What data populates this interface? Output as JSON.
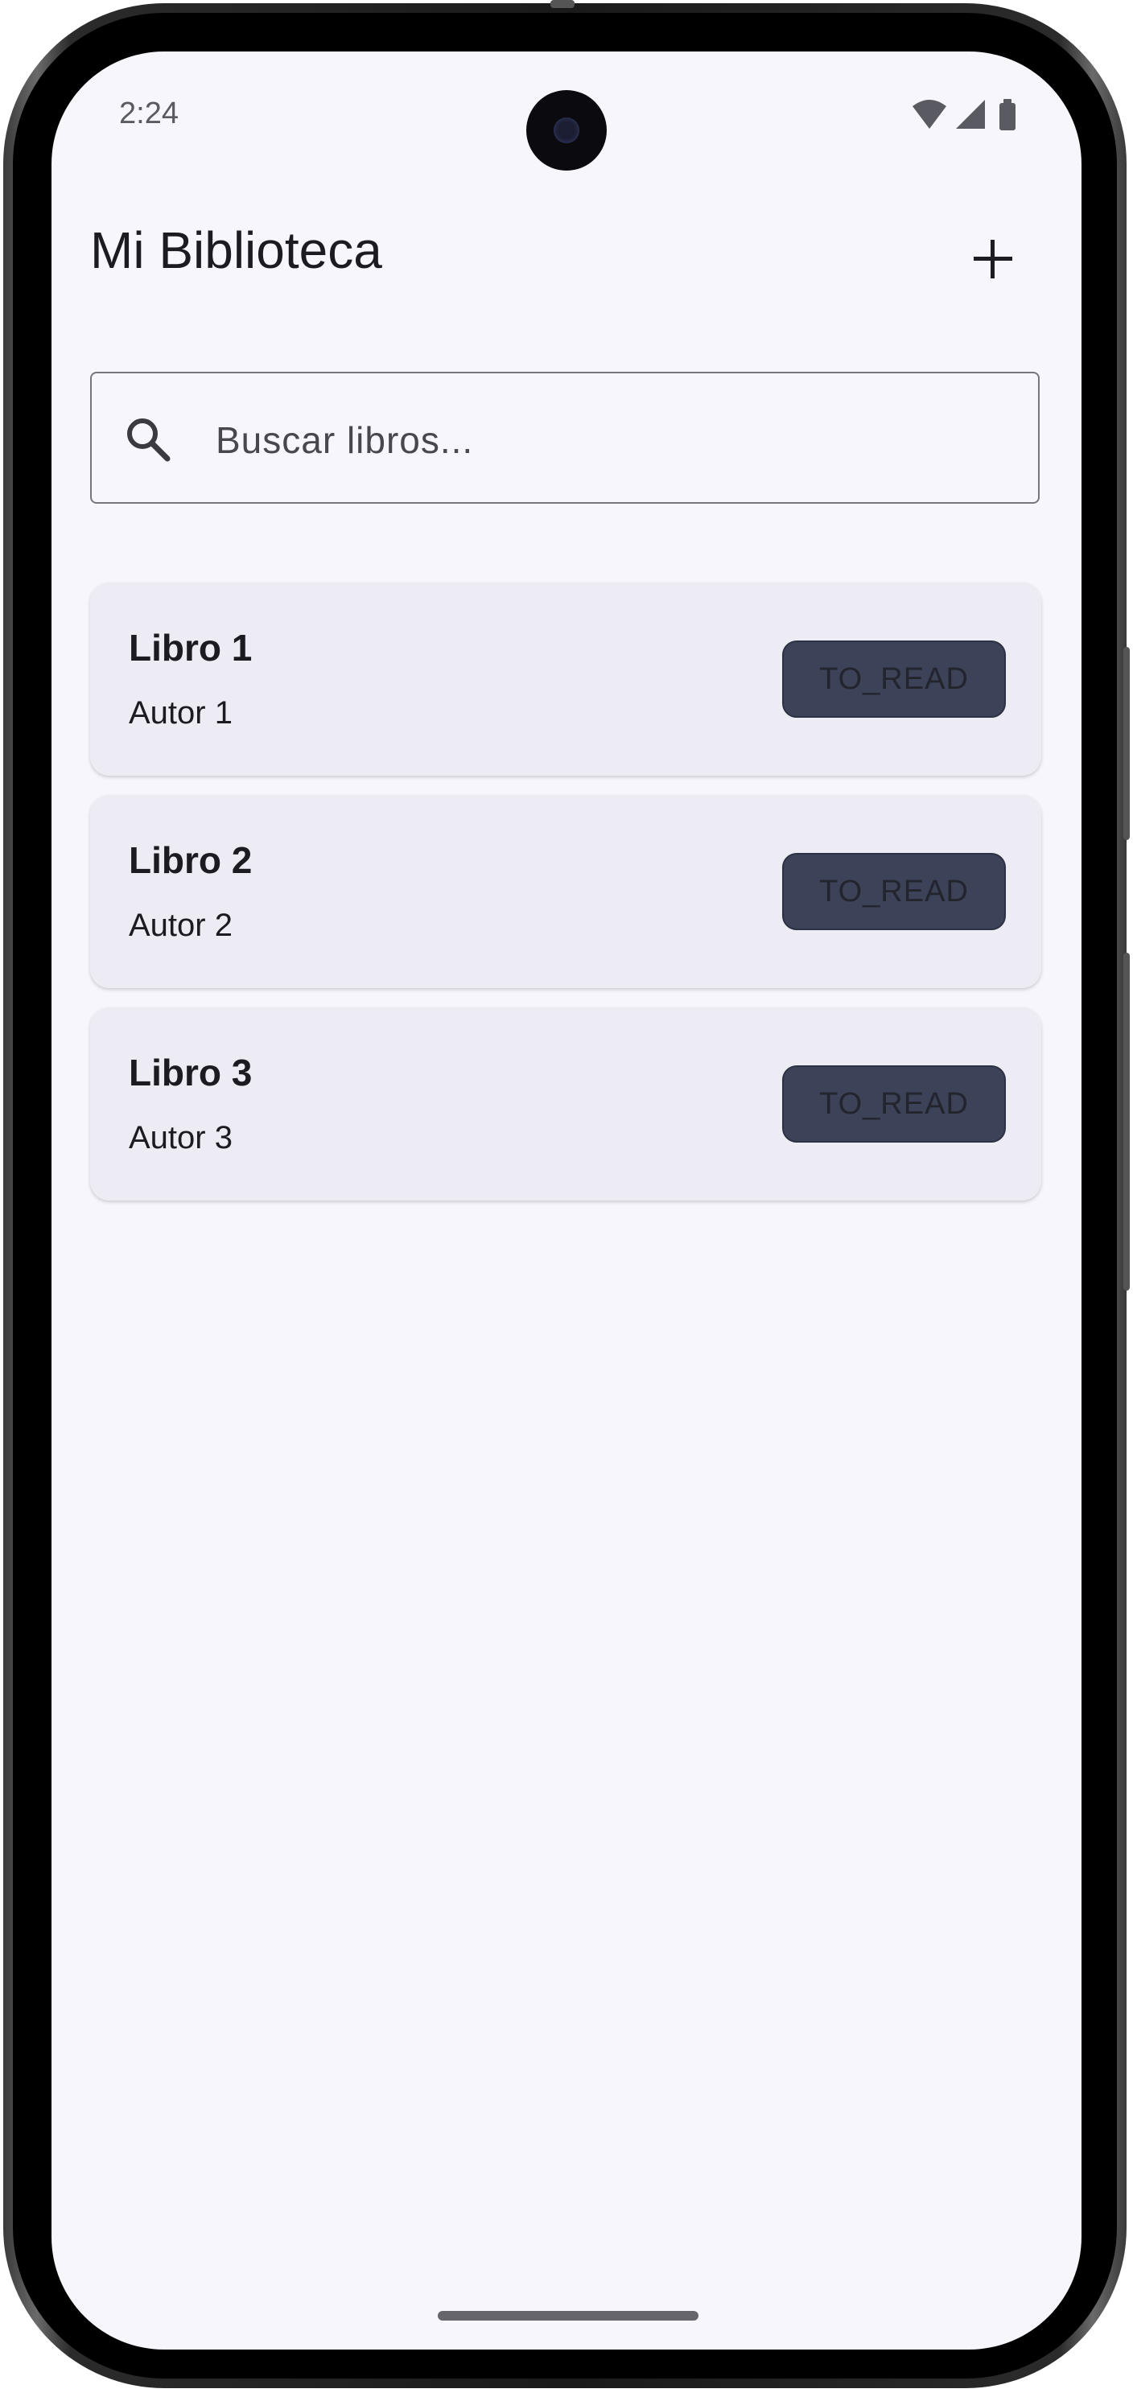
{
  "status_bar": {
    "time": "2:24",
    "icons": [
      "wifi-icon",
      "cell-signal-icon",
      "battery-icon"
    ]
  },
  "top_bar": {
    "title": "Mi Biblioteca",
    "add_icon": "plus-icon"
  },
  "search": {
    "placeholder": "Buscar libros...",
    "value": "",
    "icon": "search-icon"
  },
  "books": [
    {
      "title": "Libro 1",
      "author": "Autor 1",
      "status": "TO_READ"
    },
    {
      "title": "Libro 2",
      "author": "Autor 2",
      "status": "TO_READ"
    },
    {
      "title": "Libro 3",
      "author": "Autor 3",
      "status": "TO_READ"
    }
  ],
  "colors": {
    "background": "#f7f6fc",
    "card": "#edecf4",
    "chip": "#3c4257",
    "text": "#1c1b22"
  }
}
